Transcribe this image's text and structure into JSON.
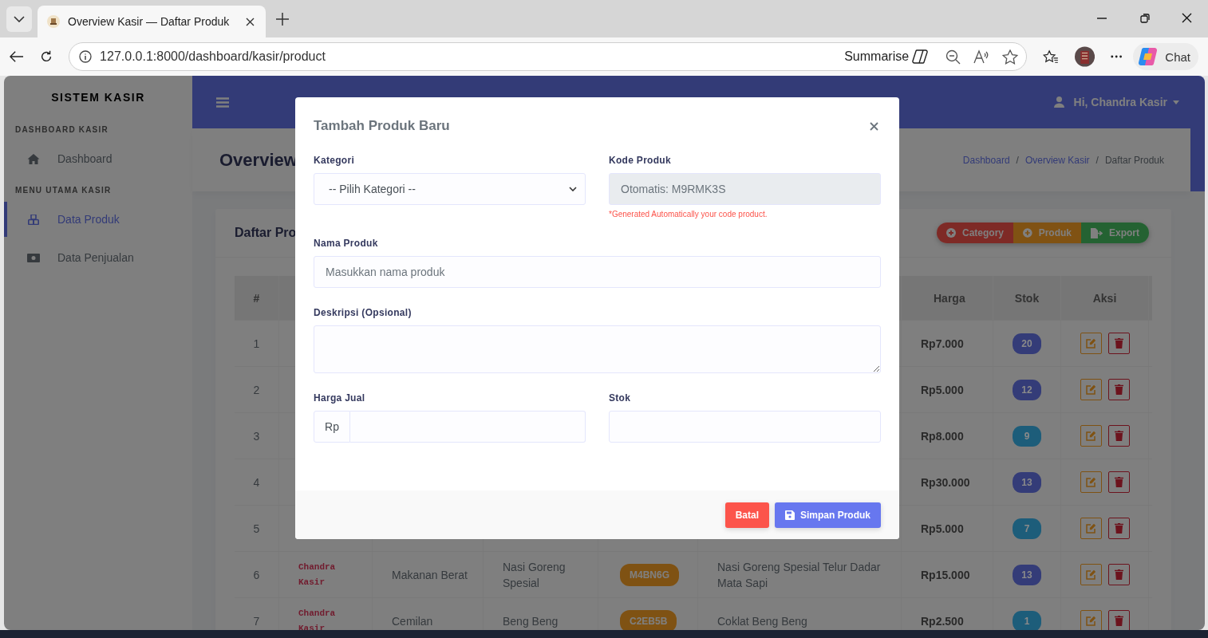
{
  "browser": {
    "tab_title": "Overview Kasir — Daftar Produk",
    "url": "127.0.0.1:8000/dashboard/kasir/product",
    "summarise": "Summarise",
    "chat": "Chat"
  },
  "sidebar": {
    "brand": "SISTEM KASIR",
    "sections": [
      {
        "heading": "DASHBOARD KASIR",
        "items": [
          {
            "label": "Dashboard",
            "selected": false
          }
        ]
      },
      {
        "heading": "MENU UTAMA KASIR",
        "items": [
          {
            "label": "Data Produk",
            "selected": true
          },
          {
            "label": "Data Penjualan",
            "selected": false
          }
        ]
      }
    ]
  },
  "navbar": {
    "user": "Hi, Chandra Kasir"
  },
  "header": {
    "title": "Overview",
    "separator": "/",
    "breadcrumb": [
      {
        "label": "Dashboard",
        "kind": "link"
      },
      {
        "label": "Overview Kasir",
        "kind": "link"
      },
      {
        "label": "Daftar Produk",
        "kind": "current"
      }
    ]
  },
  "card": {
    "title": "Daftar Pro",
    "actions": [
      {
        "label": "Category",
        "color": "#7e2a26"
      },
      {
        "label": "Produk",
        "color": "#805213"
      },
      {
        "label": "Export",
        "color": "#246232"
      }
    ]
  },
  "table": {
    "columns": [
      "#",
      null,
      null,
      null,
      null,
      null,
      "Harga",
      "Stok",
      "Aksi"
    ],
    "rows": [
      {
        "no": "1",
        "harga": "Rp7.000",
        "stok": {
          "text": "20",
          "color": "#343c78"
        }
      },
      {
        "no": "2",
        "harga": "Rp5.000",
        "stok": {
          "text": "12",
          "color": "#343c78"
        }
      },
      {
        "no": "3",
        "harga": "Rp8.000",
        "stok": {
          "text": "9",
          "color": "#1d5d7a"
        }
      },
      {
        "no": "4",
        "harga": "Rp30.000",
        "stok": {
          "text": "13",
          "color": "#343c78"
        }
      },
      {
        "no": "5",
        "harga": "Rp5.000",
        "stok": {
          "text": "7",
          "color": "#1d5d7a"
        }
      },
      {
        "no": "6",
        "user": "Chandra Kasir",
        "kategori": "Makanan Berat",
        "nama": "Nasi Goreng Spesial",
        "kode": "M4BN6G",
        "deskripsi": "Nasi Goreng Spesial Telur Dadar Mata Sapi",
        "harga": "Rp15.000",
        "stok": {
          "text": "13",
          "color": "#343c78"
        }
      },
      {
        "no": "7",
        "user": "Chandra Kasir",
        "kategori": "Cemilan",
        "nama": "Beng Beng",
        "kode": "C2EB5B",
        "deskripsi": "Coklat Beng Beng",
        "harga": "Rp2.500",
        "stok": {
          "text": "1",
          "color": "#1d5d7a"
        }
      }
    ]
  },
  "modal": {
    "title": "Tambah Produk Baru",
    "rows": [
      [
        {
          "kind": "select",
          "label": "Kategori",
          "value": "-- Pilih Kategori --",
          "disabled": false
        },
        {
          "kind": "text",
          "label": "Kode Produk",
          "value": "Otomatis: M9RMK3S",
          "disabled": true,
          "help": "*Generated Automatically your code product."
        }
      ],
      [
        {
          "kind": "text",
          "label": "Nama Produk",
          "placeholder": "Masukkan nama produk",
          "disabled": false
        }
      ],
      [
        {
          "kind": "textarea",
          "label": "Deskripsi (Opsional)",
          "disabled": false
        }
      ],
      [
        {
          "kind": "currency",
          "label": "Harga Jual",
          "prefix": "Rp",
          "disabled": false
        },
        {
          "kind": "text",
          "label": "Stok",
          "disabled": false
        }
      ]
    ],
    "buttons": [
      {
        "label": "Batal",
        "kind": "cancel"
      },
      {
        "label": "Simpan Produk",
        "kind": "save"
      }
    ]
  }
}
